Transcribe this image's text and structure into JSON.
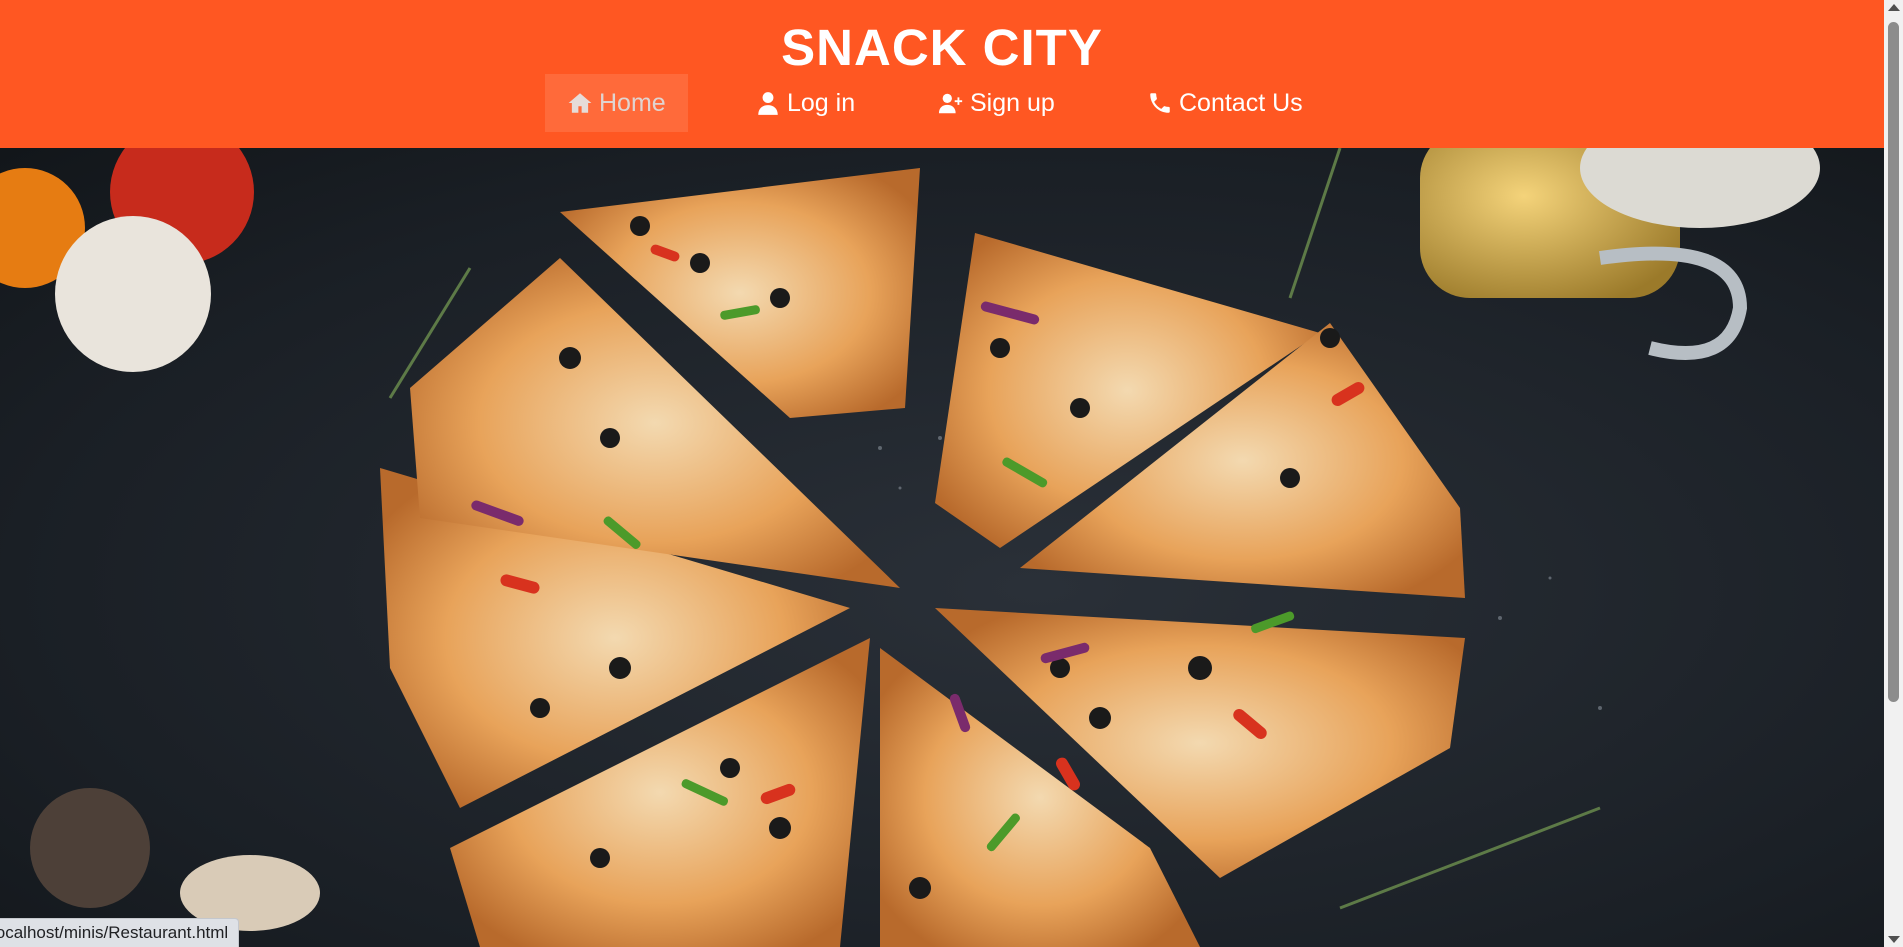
{
  "header": {
    "title": "SNACK CITY",
    "nav": [
      {
        "label": "Home",
        "icon": "home-icon",
        "active": true
      },
      {
        "label": "Log in",
        "icon": "user-icon"
      },
      {
        "label": "Sign up",
        "icon": "user-plus-icon"
      },
      {
        "label": "Contact Us",
        "icon": "phone-icon"
      }
    ]
  },
  "hero": {
    "image": "pizza-slices-photo"
  },
  "status_bar": {
    "url": "localhost/minis/Restaurant.html"
  },
  "colors": {
    "header_bg": "#ff5722",
    "active_nav_bg": "#ff6a3a",
    "text": "#ffffff"
  }
}
